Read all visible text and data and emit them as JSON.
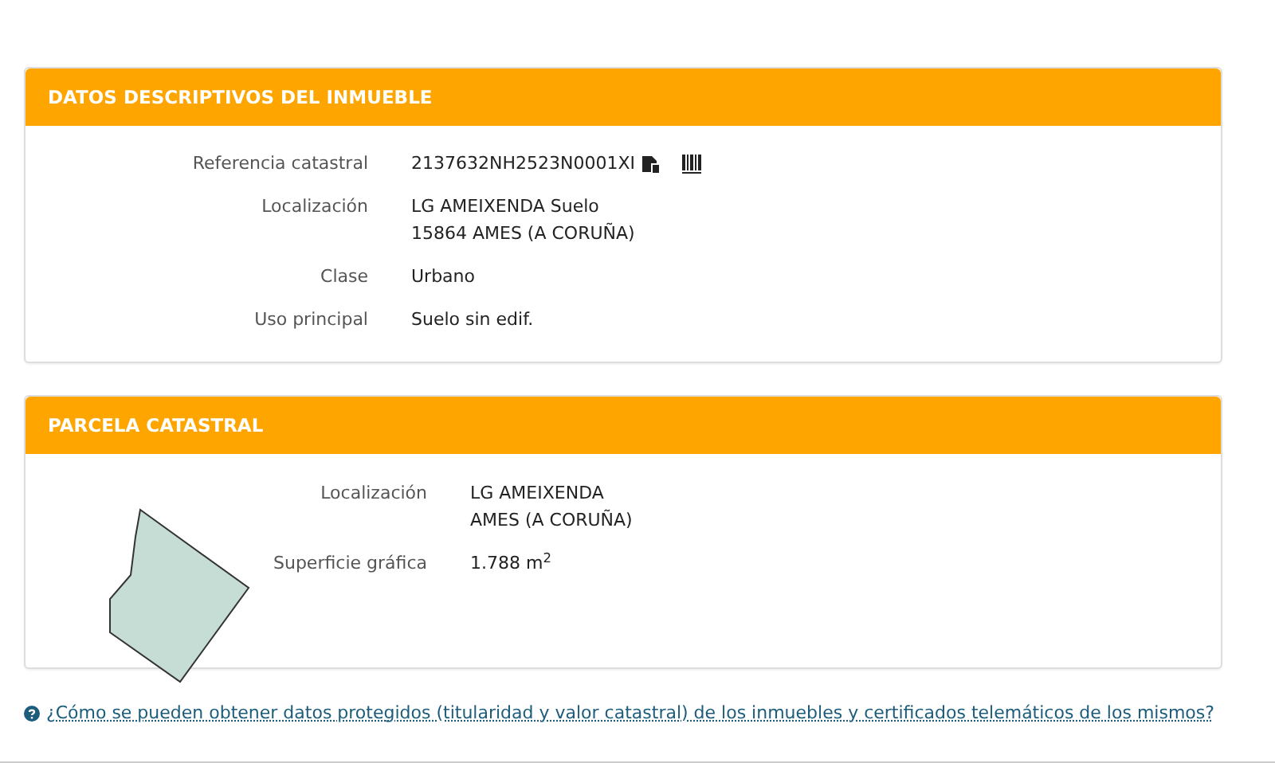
{
  "panels": [
    {
      "title": "DATOS DESCRIPTIVOS DEL INMUEBLE",
      "fields": [
        {
          "label": "Referencia catastral",
          "lines": [
            "2137632NH2523N0001XI"
          ],
          "kind": "reference"
        },
        {
          "label": "Localización",
          "lines": [
            "LG AMEIXENDA Suelo",
            "15864 AMES (A CORUÑA)"
          ],
          "kind": "text"
        },
        {
          "label": "Clase",
          "lines": [
            "Urbano"
          ],
          "kind": "text"
        },
        {
          "label": "Uso principal",
          "lines": [
            "Suelo sin edif."
          ],
          "kind": "text"
        }
      ]
    },
    {
      "title": "PARCELA CATASTRAL",
      "kind": "parcel",
      "fields": [
        {
          "label": "Localización",
          "lines": [
            "LG AMEIXENDA",
            "AMES (A CORUÑA)"
          ],
          "kind": "text"
        },
        {
          "label": "Superficie gráfica",
          "lines": [
            "1.788 m$^{2}$"
          ],
          "kind": "text"
        }
      ]
    }
  ],
  "help_link": "¿Cómo se pueden obtener datos protegidos (titularidad y valor catastral) de los inmuebles y certificados telemáticos de los mismos?"
}
